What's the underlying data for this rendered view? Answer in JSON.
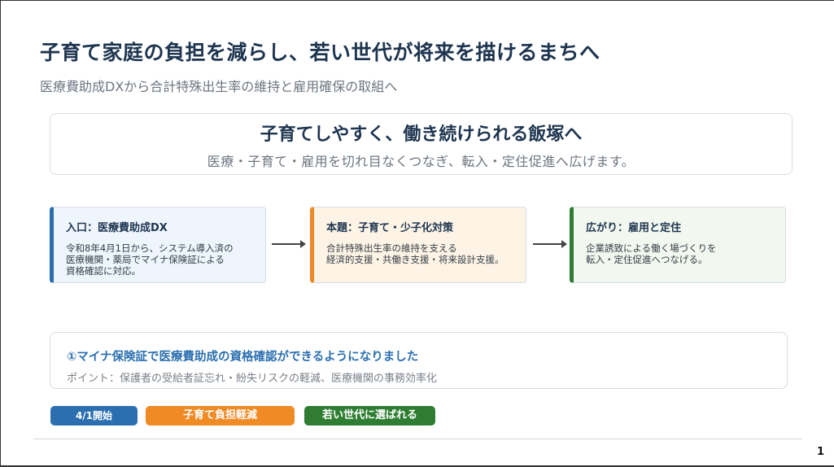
{
  "slide": {
    "title": "子育て家庭の負担を減らし、若い世代が将来を描けるまちへ",
    "subtitle": "医療費助成DXから合計特殊出生率の維持と雇用確保の取組へ"
  },
  "hero": {
    "title": "子育てしやすく、働き続けられる飯塚へ",
    "text": "医療・子育て・雇用を切れ目なくつなぎ、転入・定住促進へ広げます。"
  },
  "cards": [
    {
      "title": "入口：医療費助成DX",
      "lines": [
        "令和8年4月1日から、システム導入済の",
        "医療機関・薬局でマイナ保険証による",
        "資格確認に対応。"
      ]
    },
    {
      "title": "本題：子育て・少子化対策",
      "lines": [
        "合計特殊出生率の維持を支える",
        "経済的支援・共働き支援・将来設計支援。"
      ]
    },
    {
      "title": "広がり：雇用と定住",
      "lines": [
        "企業誘致による働く場づくりを",
        "転入・定住促進へつなげる。"
      ]
    }
  ],
  "point": {
    "title": "①マイナ保険証で医療費助成の資格確認ができるようになりました",
    "text": "ポイント：保護者の受給者証忘れ・紛失リスクの軽減、医療機関の事務効率化"
  },
  "badges": [
    "4/1開始",
    "子育て負担軽減",
    "若い世代に選ばれる"
  ],
  "page_number": "1",
  "colors": {
    "navy": "#1e3550",
    "blue": "#2b6fb0",
    "orange": "#f08a24",
    "green": "#2e7d32"
  }
}
